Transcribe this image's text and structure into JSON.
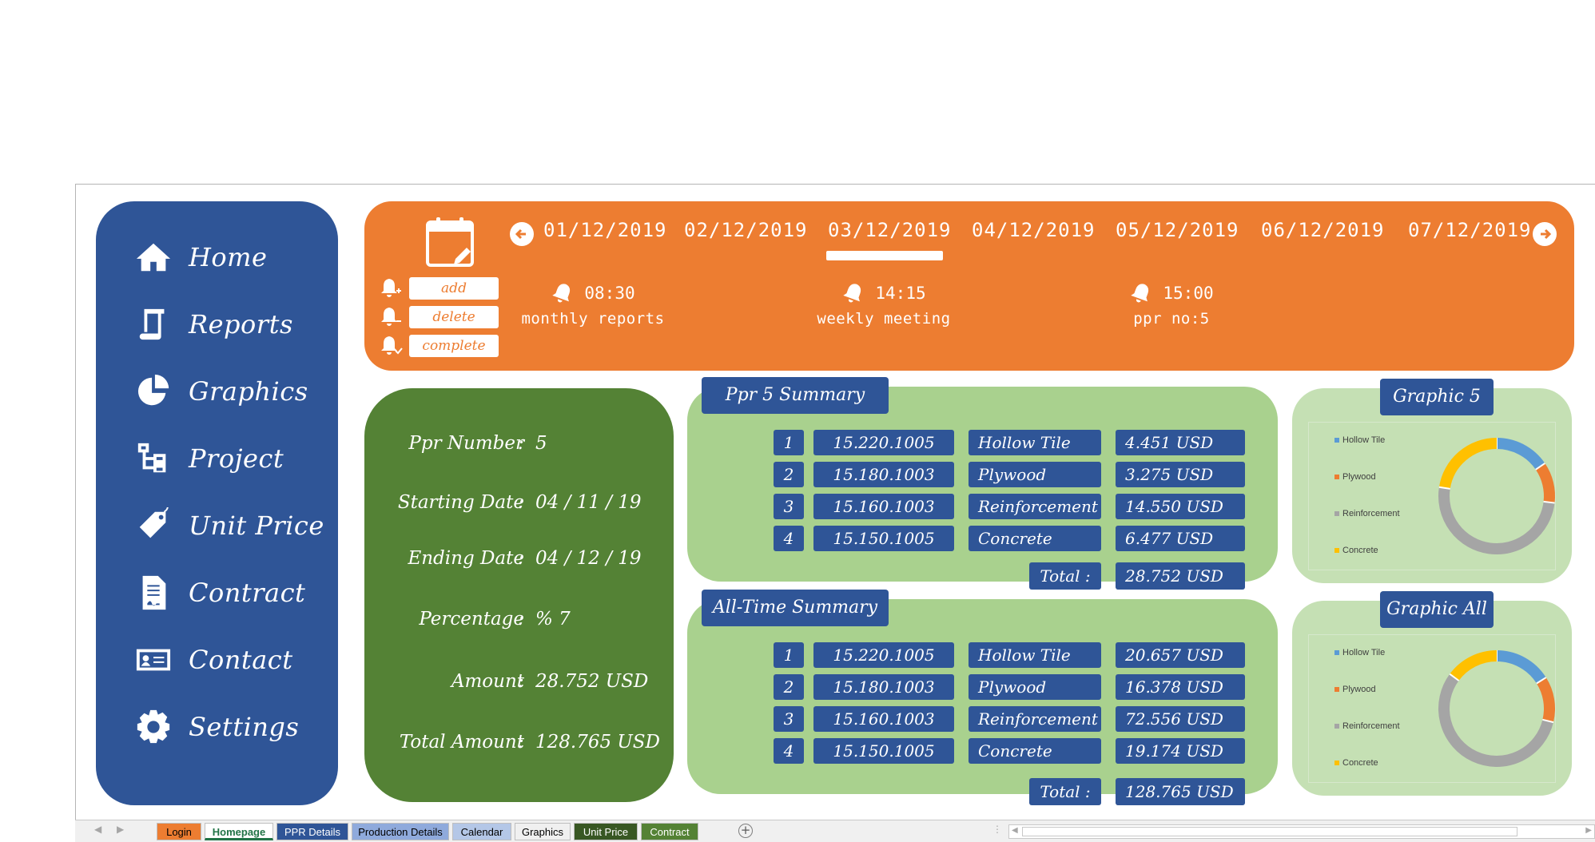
{
  "sidebar": {
    "items": [
      {
        "label": "Home",
        "icon": "home-icon"
      },
      {
        "label": "Reports",
        "icon": "scroll-icon"
      },
      {
        "label": "Graphics",
        "icon": "pie-chart-icon"
      },
      {
        "label": "Project",
        "icon": "hierarchy-icon"
      },
      {
        "label": "Unit Price",
        "icon": "price-tag-icon"
      },
      {
        "label": "Contract",
        "icon": "document-icon"
      },
      {
        "label": "Contact",
        "icon": "contact-card-icon"
      },
      {
        "label": "Settings",
        "icon": "gear-icon"
      }
    ]
  },
  "calendar": {
    "dates": [
      "01/12/2019",
      "02/12/2019",
      "03/12/2019",
      "04/12/2019",
      "05/12/2019",
      "06/12/2019",
      "07/12/2019"
    ],
    "selected_date": "03/12/2019",
    "buttons": {
      "add": "add",
      "delete": "delete",
      "complete": "complete"
    },
    "events": [
      {
        "time": "08:30",
        "name": "monthly reports"
      },
      {
        "time": "14:15",
        "name": "weekly meeting"
      },
      {
        "time": "15:00",
        "name": "ppr no:5"
      }
    ]
  },
  "ppr_details": [
    {
      "label": "Ppr Number",
      "value": "5"
    },
    {
      "label": "Starting Date",
      "value": "04 / 11 / 19"
    },
    {
      "label": "Ending Date",
      "value": "04 / 12 / 19"
    },
    {
      "label": "Percentage",
      "value": "% 7"
    },
    {
      "label": "Amount",
      "value": "28.752 USD"
    },
    {
      "label": "Total Amount",
      "value": "128.765 USD"
    }
  ],
  "ppr_summary": {
    "title": "Ppr 5 Summary",
    "rows": [
      {
        "no": "1",
        "code": "15.220.1005",
        "material": "Hollow Tile",
        "amount": "4.451 USD"
      },
      {
        "no": "2",
        "code": "15.180.1003",
        "material": "Plywood",
        "amount": "3.275 USD"
      },
      {
        "no": "3",
        "code": "15.160.1003",
        "material": "Reinforcement",
        "amount": "14.550 USD"
      },
      {
        "no": "4",
        "code": "15.150.1005",
        "material": "Concrete",
        "amount": "6.477 USD"
      }
    ],
    "total_label": "Total :",
    "total_value": "28.752 USD"
  },
  "all_time_summary": {
    "title": "All-Time Summary",
    "rows": [
      {
        "no": "1",
        "code": "15.220.1005",
        "material": "Hollow Tile",
        "amount": "20.657 USD"
      },
      {
        "no": "2",
        "code": "15.180.1003",
        "material": "Plywood",
        "amount": "16.378 USD"
      },
      {
        "no": "3",
        "code": "15.160.1003",
        "material": "Reinforcement",
        "amount": "72.556 USD"
      },
      {
        "no": "4",
        "code": "15.150.1005",
        "material": "Concrete",
        "amount": "19.174 USD"
      }
    ],
    "total_label": "Total :",
    "total_value": "128.765 USD"
  },
  "colors": {
    "primary_blue": "#2f5597",
    "orange": "#ed7d31",
    "dark_green": "#548235",
    "light_green": "#a9d18e",
    "pale_green": "#c5e0b4"
  },
  "chart_data": [
    {
      "type": "pie",
      "title": "Graphic 5",
      "categories": [
        "Hollow Tile",
        "Plywood",
        "Reinforcement",
        "Concrete"
      ],
      "values": [
        4451,
        3275,
        14550,
        6477
      ],
      "colors": [
        "#5b9bd5",
        "#ed7d31",
        "#a5a5a5",
        "#ffc000"
      ],
      "legend_position": "left"
    },
    {
      "type": "pie",
      "title": "Graphic All",
      "categories": [
        "Hollow Tile",
        "Plywood",
        "Reinforcement",
        "Concrete"
      ],
      "values": [
        20657,
        16378,
        72556,
        19174
      ],
      "colors": [
        "#5b9bd5",
        "#ed7d31",
        "#a5a5a5",
        "#ffc000"
      ],
      "legend_position": "left"
    }
  ],
  "tabs": [
    {
      "label": "Login",
      "bg": "#ed7d31",
      "fg": "#000000"
    },
    {
      "label": "Homepage",
      "bg": "#ffffff",
      "fg": "#217346",
      "active": true
    },
    {
      "label": "PPR Details",
      "bg": "#2f5597",
      "fg": "#ffffff"
    },
    {
      "label": "Production Details",
      "bg": "#8faadc",
      "fg": "#000000"
    },
    {
      "label": "Calendar",
      "bg": "#b4c7e7",
      "fg": "#000000"
    },
    {
      "label": "Graphics",
      "bg": "#f0f0f0",
      "fg": "#000000"
    },
    {
      "label": "Unit Price",
      "bg": "#385723",
      "fg": "#ffffff"
    },
    {
      "label": "Contract",
      "bg": "#548235",
      "fg": "#ffffff"
    }
  ]
}
